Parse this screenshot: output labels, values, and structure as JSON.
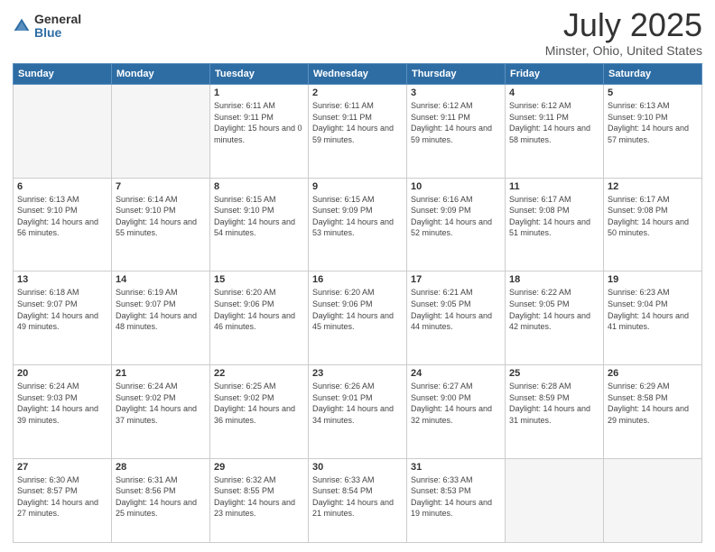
{
  "header": {
    "logo_general": "General",
    "logo_blue": "Blue",
    "month": "July 2025",
    "location": "Minster, Ohio, United States"
  },
  "days_of_week": [
    "Sunday",
    "Monday",
    "Tuesday",
    "Wednesday",
    "Thursday",
    "Friday",
    "Saturday"
  ],
  "weeks": [
    [
      {
        "day": "",
        "sunrise": "",
        "sunset": "",
        "daylight": ""
      },
      {
        "day": "",
        "sunrise": "",
        "sunset": "",
        "daylight": ""
      },
      {
        "day": "1",
        "sunrise": "Sunrise: 6:11 AM",
        "sunset": "Sunset: 9:11 PM",
        "daylight": "Daylight: 15 hours and 0 minutes."
      },
      {
        "day": "2",
        "sunrise": "Sunrise: 6:11 AM",
        "sunset": "Sunset: 9:11 PM",
        "daylight": "Daylight: 14 hours and 59 minutes."
      },
      {
        "day": "3",
        "sunrise": "Sunrise: 6:12 AM",
        "sunset": "Sunset: 9:11 PM",
        "daylight": "Daylight: 14 hours and 59 minutes."
      },
      {
        "day": "4",
        "sunrise": "Sunrise: 6:12 AM",
        "sunset": "Sunset: 9:11 PM",
        "daylight": "Daylight: 14 hours and 58 minutes."
      },
      {
        "day": "5",
        "sunrise": "Sunrise: 6:13 AM",
        "sunset": "Sunset: 9:10 PM",
        "daylight": "Daylight: 14 hours and 57 minutes."
      }
    ],
    [
      {
        "day": "6",
        "sunrise": "Sunrise: 6:13 AM",
        "sunset": "Sunset: 9:10 PM",
        "daylight": "Daylight: 14 hours and 56 minutes."
      },
      {
        "day": "7",
        "sunrise": "Sunrise: 6:14 AM",
        "sunset": "Sunset: 9:10 PM",
        "daylight": "Daylight: 14 hours and 55 minutes."
      },
      {
        "day": "8",
        "sunrise": "Sunrise: 6:15 AM",
        "sunset": "Sunset: 9:10 PM",
        "daylight": "Daylight: 14 hours and 54 minutes."
      },
      {
        "day": "9",
        "sunrise": "Sunrise: 6:15 AM",
        "sunset": "Sunset: 9:09 PM",
        "daylight": "Daylight: 14 hours and 53 minutes."
      },
      {
        "day": "10",
        "sunrise": "Sunrise: 6:16 AM",
        "sunset": "Sunset: 9:09 PM",
        "daylight": "Daylight: 14 hours and 52 minutes."
      },
      {
        "day": "11",
        "sunrise": "Sunrise: 6:17 AM",
        "sunset": "Sunset: 9:08 PM",
        "daylight": "Daylight: 14 hours and 51 minutes."
      },
      {
        "day": "12",
        "sunrise": "Sunrise: 6:17 AM",
        "sunset": "Sunset: 9:08 PM",
        "daylight": "Daylight: 14 hours and 50 minutes."
      }
    ],
    [
      {
        "day": "13",
        "sunrise": "Sunrise: 6:18 AM",
        "sunset": "Sunset: 9:07 PM",
        "daylight": "Daylight: 14 hours and 49 minutes."
      },
      {
        "day": "14",
        "sunrise": "Sunrise: 6:19 AM",
        "sunset": "Sunset: 9:07 PM",
        "daylight": "Daylight: 14 hours and 48 minutes."
      },
      {
        "day": "15",
        "sunrise": "Sunrise: 6:20 AM",
        "sunset": "Sunset: 9:06 PM",
        "daylight": "Daylight: 14 hours and 46 minutes."
      },
      {
        "day": "16",
        "sunrise": "Sunrise: 6:20 AM",
        "sunset": "Sunset: 9:06 PM",
        "daylight": "Daylight: 14 hours and 45 minutes."
      },
      {
        "day": "17",
        "sunrise": "Sunrise: 6:21 AM",
        "sunset": "Sunset: 9:05 PM",
        "daylight": "Daylight: 14 hours and 44 minutes."
      },
      {
        "day": "18",
        "sunrise": "Sunrise: 6:22 AM",
        "sunset": "Sunset: 9:05 PM",
        "daylight": "Daylight: 14 hours and 42 minutes."
      },
      {
        "day": "19",
        "sunrise": "Sunrise: 6:23 AM",
        "sunset": "Sunset: 9:04 PM",
        "daylight": "Daylight: 14 hours and 41 minutes."
      }
    ],
    [
      {
        "day": "20",
        "sunrise": "Sunrise: 6:24 AM",
        "sunset": "Sunset: 9:03 PM",
        "daylight": "Daylight: 14 hours and 39 minutes."
      },
      {
        "day": "21",
        "sunrise": "Sunrise: 6:24 AM",
        "sunset": "Sunset: 9:02 PM",
        "daylight": "Daylight: 14 hours and 37 minutes."
      },
      {
        "day": "22",
        "sunrise": "Sunrise: 6:25 AM",
        "sunset": "Sunset: 9:02 PM",
        "daylight": "Daylight: 14 hours and 36 minutes."
      },
      {
        "day": "23",
        "sunrise": "Sunrise: 6:26 AM",
        "sunset": "Sunset: 9:01 PM",
        "daylight": "Daylight: 14 hours and 34 minutes."
      },
      {
        "day": "24",
        "sunrise": "Sunrise: 6:27 AM",
        "sunset": "Sunset: 9:00 PM",
        "daylight": "Daylight: 14 hours and 32 minutes."
      },
      {
        "day": "25",
        "sunrise": "Sunrise: 6:28 AM",
        "sunset": "Sunset: 8:59 PM",
        "daylight": "Daylight: 14 hours and 31 minutes."
      },
      {
        "day": "26",
        "sunrise": "Sunrise: 6:29 AM",
        "sunset": "Sunset: 8:58 PM",
        "daylight": "Daylight: 14 hours and 29 minutes."
      }
    ],
    [
      {
        "day": "27",
        "sunrise": "Sunrise: 6:30 AM",
        "sunset": "Sunset: 8:57 PM",
        "daylight": "Daylight: 14 hours and 27 minutes."
      },
      {
        "day": "28",
        "sunrise": "Sunrise: 6:31 AM",
        "sunset": "Sunset: 8:56 PM",
        "daylight": "Daylight: 14 hours and 25 minutes."
      },
      {
        "day": "29",
        "sunrise": "Sunrise: 6:32 AM",
        "sunset": "Sunset: 8:55 PM",
        "daylight": "Daylight: 14 hours and 23 minutes."
      },
      {
        "day": "30",
        "sunrise": "Sunrise: 6:33 AM",
        "sunset": "Sunset: 8:54 PM",
        "daylight": "Daylight: 14 hours and 21 minutes."
      },
      {
        "day": "31",
        "sunrise": "Sunrise: 6:33 AM",
        "sunset": "Sunset: 8:53 PM",
        "daylight": "Daylight: 14 hours and 19 minutes."
      },
      {
        "day": "",
        "sunrise": "",
        "sunset": "",
        "daylight": ""
      },
      {
        "day": "",
        "sunrise": "",
        "sunset": "",
        "daylight": ""
      }
    ]
  ]
}
